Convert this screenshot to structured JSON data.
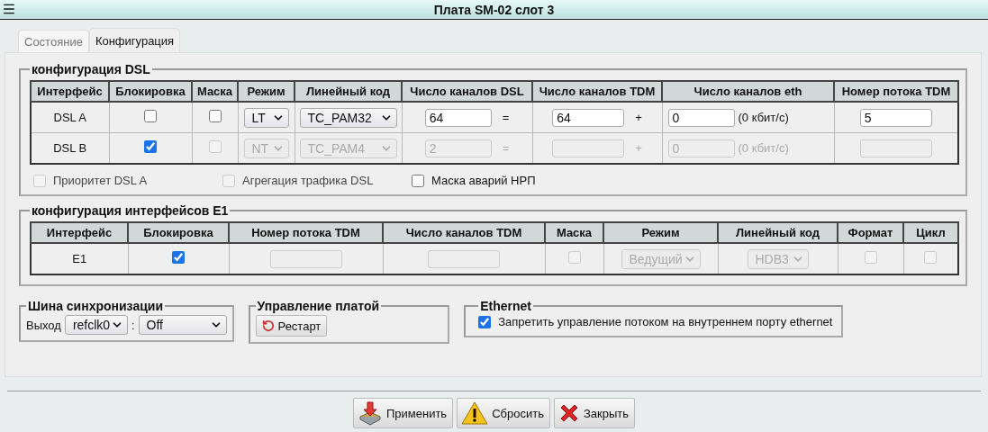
{
  "window": {
    "title": "Плата SM-02 слот 3"
  },
  "tabs": [
    {
      "label": "Состояние",
      "selected": false
    },
    {
      "label": "Конфигурация",
      "selected": true
    }
  ],
  "dsl": {
    "legend": "конфигурация DSL",
    "columns": [
      "Интерфейс",
      "Блокировка",
      "Маска",
      "Режим",
      "Линейный код",
      "Число каналов DSL",
      "Число каналов TDM",
      "Число каналов eth",
      "Номер потока TDM"
    ],
    "rows": [
      {
        "interface": "DSL A",
        "disabled": false,
        "blocked": false,
        "mask": false,
        "mode": "LT",
        "line_code": "TC_PAM32",
        "dsl_channels": "64",
        "eq_sign": "=",
        "tdm_channels": "64",
        "plus_sign": "+",
        "eth_channels": "0",
        "eth_rate": "(0 кбит/с)",
        "tdm_stream": "5"
      },
      {
        "interface": "DSL B",
        "disabled": true,
        "blocked": true,
        "mask": false,
        "mode": "NT",
        "line_code": "TC_PAM4",
        "dsl_channels": "2",
        "eq_sign": "=",
        "plus_sign": "+",
        "eth_channels": "0",
        "eth_rate": "(0 кбит/с)"
      }
    ],
    "options": [
      {
        "label": "Приоритет DSL A",
        "checked": false,
        "disabled": true
      },
      {
        "label": "Агрегация трафика DSL",
        "checked": false,
        "disabled": true
      },
      {
        "label": "Маска аварий НРП",
        "checked": false,
        "disabled": false
      }
    ]
  },
  "e1": {
    "legend": "конфигурация интерфейсов E1",
    "columns": [
      "Интерфейс",
      "Блокировка",
      "Номер потока TDM",
      "Число каналов TDM",
      "Маска",
      "Режим",
      "Линейный код",
      "Формат",
      "Цикл"
    ],
    "rows": [
      {
        "interface": "E1",
        "disabled": true,
        "blocked": true,
        "mask": false,
        "mode": "Ведущий",
        "line_code": "HDB3",
        "format": false,
        "cycle": false
      }
    ]
  },
  "sync": {
    "legend": "Шина синхронизации",
    "label": "Выход",
    "source": "refclk0",
    "separator": ":",
    "value": "Off"
  },
  "board": {
    "legend": "Управление платой",
    "restart": "Рестарт"
  },
  "ethernet": {
    "legend": "Ethernet",
    "label": "Запретить управление потоком на внутреннем порту ethernet",
    "checked": true
  },
  "buttons": [
    {
      "label": "Применить",
      "kind": "apply"
    },
    {
      "label": "Сбросить",
      "kind": "reset"
    },
    {
      "label": "Закрыть",
      "kind": "close"
    }
  ]
}
